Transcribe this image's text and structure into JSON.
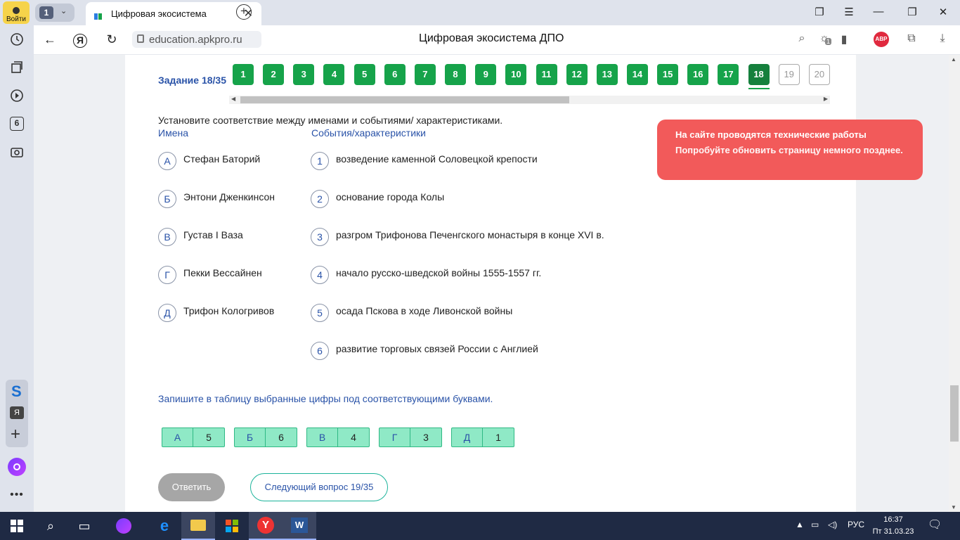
{
  "browser": {
    "login_label": "Войти",
    "tab_count": "1",
    "tab_title": "Цифровая экосистема",
    "url": "education.apkpro.ru",
    "page_title": "Цифровая экосистема ДПО",
    "abp_label": "ABP",
    "ext_badge": "1",
    "sidebar_badge": "6",
    "sidebar_ya": "Я"
  },
  "quiz": {
    "task_label": "Задание 18/35",
    "questions": [
      {
        "n": "1",
        "state": "done"
      },
      {
        "n": "2",
        "state": "done"
      },
      {
        "n": "3",
        "state": "done"
      },
      {
        "n": "4",
        "state": "done"
      },
      {
        "n": "5",
        "state": "done"
      },
      {
        "n": "6",
        "state": "done"
      },
      {
        "n": "7",
        "state": "done"
      },
      {
        "n": "8",
        "state": "done"
      },
      {
        "n": "9",
        "state": "done"
      },
      {
        "n": "10",
        "state": "done"
      },
      {
        "n": "11",
        "state": "done"
      },
      {
        "n": "12",
        "state": "done"
      },
      {
        "n": "13",
        "state": "done"
      },
      {
        "n": "14",
        "state": "done"
      },
      {
        "n": "15",
        "state": "done"
      },
      {
        "n": "16",
        "state": "done"
      },
      {
        "n": "17",
        "state": "done"
      },
      {
        "n": "18",
        "state": "current"
      },
      {
        "n": "19",
        "state": "todo"
      },
      {
        "n": "20",
        "state": "todo"
      }
    ],
    "prompt": "Установите соответствие между именами и событиями/ характеристиками.",
    "names_header": "Имена",
    "events_header": "События/характеристики",
    "names": [
      {
        "key": "А",
        "text": "Стефан Баторий"
      },
      {
        "key": "Б",
        "text": "Энтони Дженкинсон"
      },
      {
        "key": "В",
        "text": "Густав I Ваза"
      },
      {
        "key": "Г",
        "text": "Пекки Вессайнен"
      },
      {
        "key": "Д",
        "text": "Трифон Кологривов"
      }
    ],
    "events": [
      {
        "key": "1",
        "text": "возведение каменной Соловецкой крепости"
      },
      {
        "key": "2",
        "text": "основание города Колы"
      },
      {
        "key": "3",
        "text": "разгром Трифонова Печенгского монастыря в конце XVI в."
      },
      {
        "key": "4",
        "text": "начало русско-шведской войны 1555-1557 гг."
      },
      {
        "key": "5",
        "text": "осада Пскова в ходе Ливонской войны"
      },
      {
        "key": "6",
        "text": "развитие торговых связей России с Англией"
      }
    ],
    "instruction": "Запишите в таблицу выбранные цифры под соответствующими буквами.",
    "answers": [
      {
        "letter": "А",
        "value": "5"
      },
      {
        "letter": "Б",
        "value": "6"
      },
      {
        "letter": "В",
        "value": "4"
      },
      {
        "letter": "Г",
        "value": "3"
      },
      {
        "letter": "Д",
        "value": "1"
      }
    ],
    "answer_button": "Ответить",
    "next_button": "Следующий вопрос 19/35"
  },
  "toast": {
    "title": "На сайте проводятся технические работы",
    "message": "Попробуйте обновить страницу немного позднее."
  },
  "taskbar": {
    "lang": "РУС",
    "time": "16:37",
    "date": "Пт 31.03.23"
  }
}
